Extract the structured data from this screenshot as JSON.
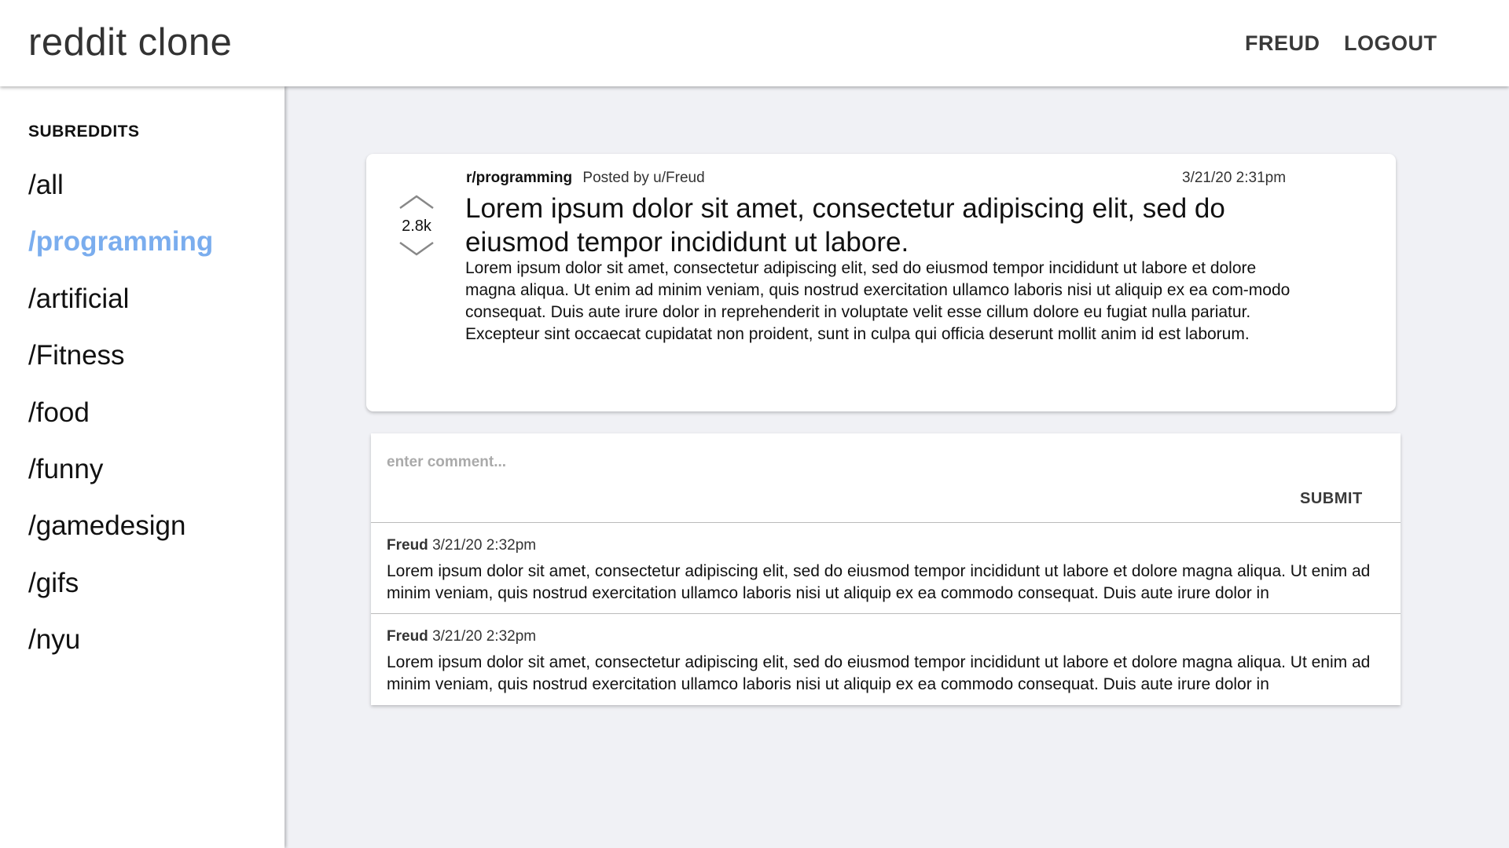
{
  "header": {
    "title": "reddit clone",
    "username": "FREUD",
    "logout_label": "LOGOUT"
  },
  "sidebar": {
    "heading": "SUBREDDITS",
    "items": [
      {
        "label": "/all"
      },
      {
        "label": "/programming",
        "active": true
      },
      {
        "label": "/artificial"
      },
      {
        "label": "/Fitness"
      },
      {
        "label": "/food"
      },
      {
        "label": "/funny"
      },
      {
        "label": "/gamedesign"
      },
      {
        "label": "/gifs"
      },
      {
        "label": "/nyu"
      }
    ]
  },
  "post": {
    "subreddit": "r/programming",
    "posted_by": "Posted by u/Freud",
    "timestamp": "3/21/20 2:31pm",
    "vote_count": "2.8k",
    "title": "Lorem ipsum dolor sit amet, consectetur adipiscing elit, sed do eiusmod tempor incididunt ut labore.",
    "body": "Lorem ipsum dolor sit amet, consectetur adipiscing elit, sed do eiusmod tempor incididunt ut labore et dolore magna aliqua. Ut enim ad minim veniam, quis nostrud exercitation ullamco laboris nisi ut aliquip ex ea com-modo consequat. Duis aute irure dolor in reprehenderit in voluptate velit esse cillum dolore eu fugiat nulla pariatur. Excepteur sint occaecat cupidatat non proident, sunt in culpa qui officia deserunt mollit anim id est laborum."
  },
  "comment_form": {
    "placeholder": "enter comment...",
    "submit_label": "SUBMIT"
  },
  "comments": [
    {
      "author": "Freud",
      "timestamp": "3/21/20 2:32pm",
      "text": "Lorem ipsum dolor sit amet, consectetur adipiscing elit, sed do eiusmod tempor incididunt ut labore et dolore magna aliqua. Ut enim ad minim veniam, quis nostrud exercitation ullamco laboris nisi ut aliquip ex ea commodo consequat. Duis aute irure dolor in"
    },
    {
      "author": "Freud",
      "timestamp": "3/21/20 2:32pm",
      "text": "Lorem ipsum dolor sit amet, consectetur adipiscing elit, sed do eiusmod tempor incididunt ut labore et dolore magna aliqua. Ut enim ad minim veniam, quis nostrud exercitation ullamco laboris nisi ut aliquip ex ea commodo consequat. Duis aute irure dolor in"
    }
  ],
  "colors": {
    "accent": "#7aadee",
    "background": "#f0f1f5"
  }
}
